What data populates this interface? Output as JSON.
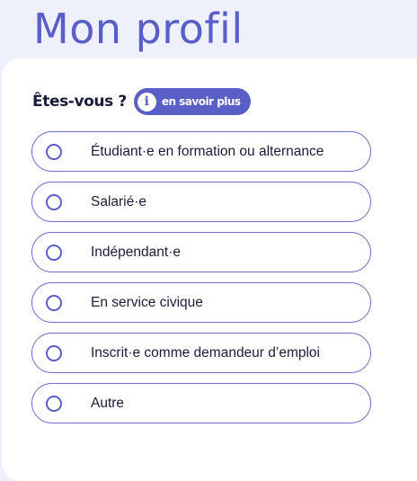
{
  "page": {
    "title": "Mon profil"
  },
  "question": {
    "label": "Êtes-vous ?",
    "info_icon": "info-icon",
    "info_glyph": "i",
    "info_label": "en savoir plus"
  },
  "options": [
    {
      "label": "Étudiant·e en formation ou alternance",
      "selected": false
    },
    {
      "label": "Salarié·e",
      "selected": false
    },
    {
      "label": "Indépendant·e",
      "selected": false
    },
    {
      "label": "En service civique",
      "selected": false
    },
    {
      "label": "Inscrit·e comme demandeur d’emploi",
      "selected": false
    },
    {
      "label": "Autre",
      "selected": false
    }
  ],
  "colors": {
    "accent": "#5a5fc7",
    "background": "#eef0fb",
    "card": "#ffffff",
    "text": "#1b1c3a"
  }
}
